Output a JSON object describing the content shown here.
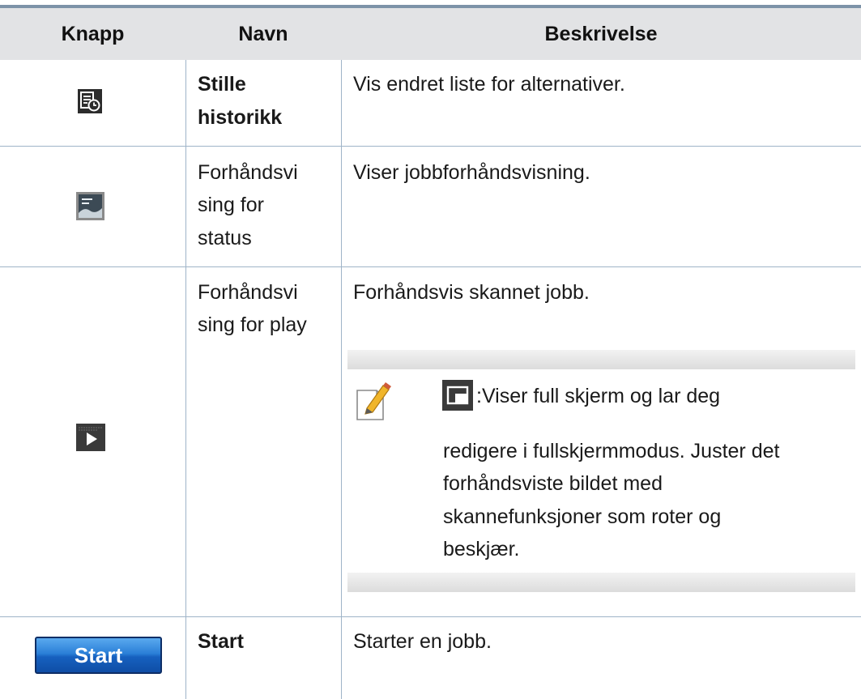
{
  "table": {
    "headers": {
      "button": "Knapp",
      "name": "Navn",
      "description": "Beskrivelse"
    },
    "rows": [
      {
        "name_line1": "Stille",
        "name_line2": "historikk",
        "description": "Vis endret liste for alternativer.",
        "icon": "history-icon"
      },
      {
        "name_line1": "Forhåndsvi",
        "name_line2": "sing for",
        "name_line3": "status",
        "description": "Viser jobbforhåndsvisning.",
        "icon": "image-preview-icon"
      },
      {
        "name_line1": "Forhåndsvi",
        "name_line2": "sing for play",
        "description": "Forhåndsvis skannet jobb.",
        "icon": "play-icon",
        "note": {
          "line1": ":Viser full skjerm og lar deg",
          "line2": "redigere i fullskjermmodus. Juster det",
          "line3": "forhåndsviste bildet med",
          "line4": "skannefunksjoner som roter og",
          "line5": "beskjær.",
          "icons": [
            "note-pencil-icon",
            "fullscreen-icon"
          ]
        }
      },
      {
        "name_line1": "Start",
        "description": "Starter en jobb.",
        "button_label": "Start"
      }
    ]
  },
  "colors": {
    "header_bg": "#e2e3e5",
    "grid_line": "#9fb4c8",
    "top_rule": "#7d93a8",
    "start_button": "#1d6cc8"
  }
}
